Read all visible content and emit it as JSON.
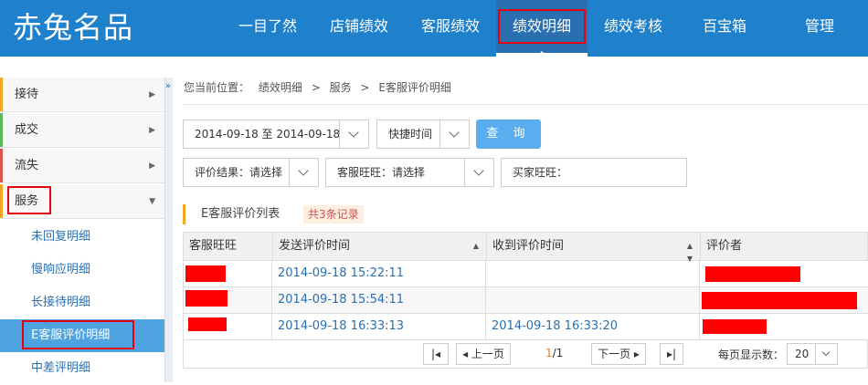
{
  "header": {
    "logo": "赤兔名品",
    "nav": [
      {
        "label": "一目了然"
      },
      {
        "label": "店铺绩效"
      },
      {
        "label": "客服绩效"
      },
      {
        "label": "绩效明细"
      },
      {
        "label": "绩效考核"
      },
      {
        "label": "百宝箱"
      },
      {
        "label": "管理"
      }
    ],
    "active_nav": "绩效明细"
  },
  "sidebar": {
    "groups": [
      {
        "label": "接待",
        "color": "#f5a623"
      },
      {
        "label": "成交",
        "color": "#5cb85c"
      },
      {
        "label": "流失",
        "color": "#d9534f"
      },
      {
        "label": "服务",
        "color": "#f5a623"
      }
    ],
    "sub_items": [
      {
        "label": "未回复明细"
      },
      {
        "label": "慢响应明细"
      },
      {
        "label": "长接待明细"
      },
      {
        "label": "E客服评价明细"
      },
      {
        "label": "中差评明细"
      }
    ],
    "collapse_glyph": "»"
  },
  "breadcrumb": {
    "prefix": "您当前位置：",
    "items": [
      "绩效明细",
      "服务",
      "E客服评价明细"
    ],
    "sep": ">"
  },
  "filters": {
    "date_range": "2014-09-18 至 2014-09-18",
    "quick_time": "快捷时间",
    "query_button": "查 询",
    "rating_result": "评价结果：请选择",
    "service_wangwang": "客服旺旺：请选择",
    "buyer_wangwang": "买家旺旺："
  },
  "section": {
    "title": "E客服评价列表",
    "record_count": "共3条记录"
  },
  "table": {
    "columns": [
      "客服旺旺",
      "发送评价时间",
      "收到评价时间",
      "评价者"
    ],
    "rows": [
      {
        "sent_time": "2014-09-18 15:22:11",
        "received_time": ""
      },
      {
        "sent_time": "2014-09-18 15:54:11",
        "received_time": ""
      },
      {
        "sent_time": "2014-09-18 16:33:13",
        "received_time": "2014-09-18 16:33:20"
      }
    ]
  },
  "pager": {
    "first": "|◂",
    "prev": "◂ 上一页",
    "current": "1",
    "total": "/1",
    "next": "下一页 ▸",
    "last": "▸|",
    "per_page_label": "每页显示数：",
    "per_page_value": "20"
  }
}
